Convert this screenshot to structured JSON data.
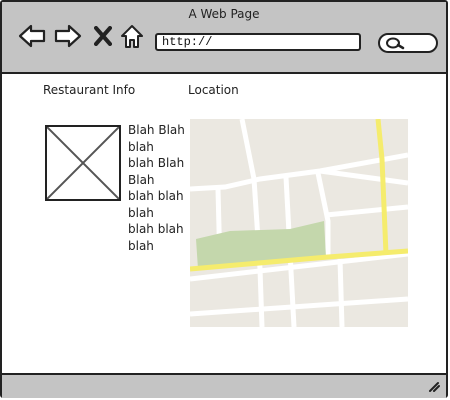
{
  "window": {
    "title": "A Web Page"
  },
  "toolbar": {
    "icons": [
      "back-arrow-icon",
      "forward-arrow-icon",
      "close-icon",
      "home-icon"
    ],
    "address": "http://",
    "search_icon": "search-icon"
  },
  "content": {
    "restaurant_heading": "Restaurant Info",
    "location_heading": "Location",
    "description_lines": [
      "Blah Blah",
      "blah",
      "blah Blah",
      "Blah",
      "blah blah",
      "blah",
      "blah blah",
      "blah"
    ],
    "image": "image-placeholder",
    "map": "map-placeholder"
  },
  "colors": {
    "chrome": "#c4c4c4",
    "map_background": "#ebe8e1",
    "park": "#c4d7ac",
    "road_highlight": "#f5ec6d"
  }
}
